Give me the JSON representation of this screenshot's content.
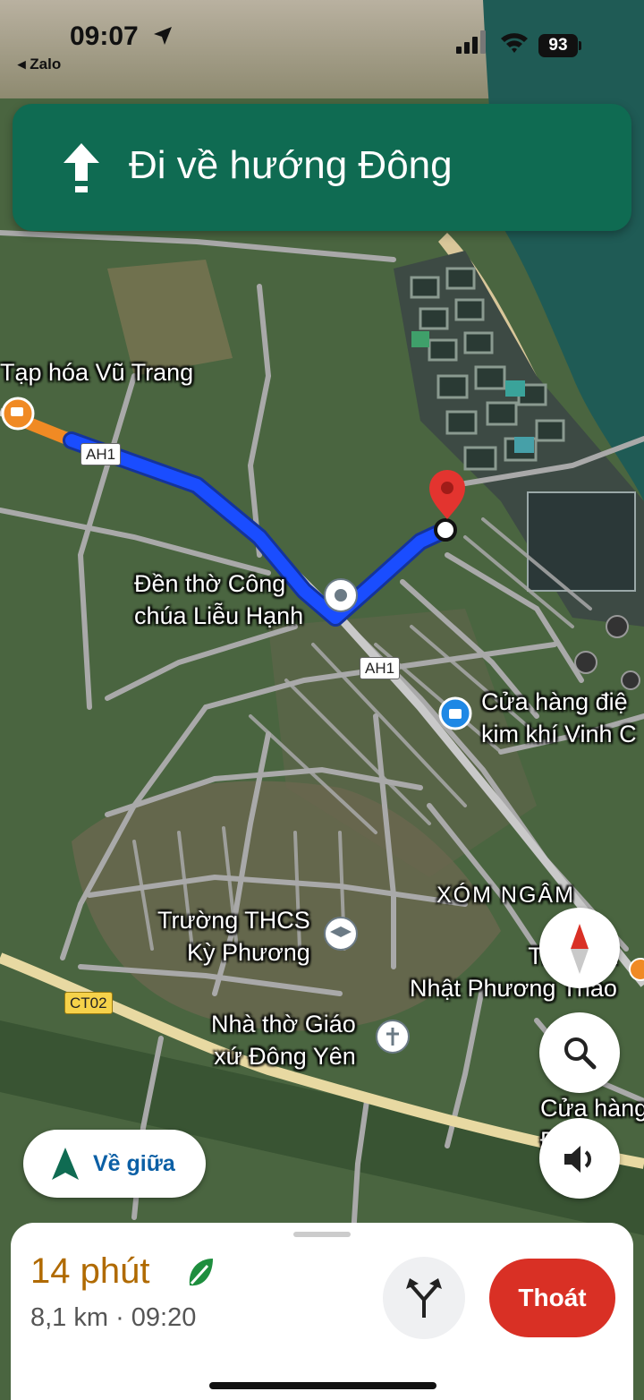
{
  "status_bar": {
    "time": "09:07",
    "back_app": "◂ Zalo",
    "battery": "93"
  },
  "navigation": {
    "instruction": "Đi về hướng Đông",
    "direction_icon": "straight-arrow-icon"
  },
  "map": {
    "places": [
      {
        "id": "tap-hoa",
        "name": "Tạp hóa Vũ Trang"
      },
      {
        "id": "den-tho",
        "name": "Đền thờ Công\nchúa Liễu Hạnh"
      },
      {
        "id": "cua-hang-dien",
        "name": "Cửa hàng điệ\nkim khí Vinh C"
      },
      {
        "id": "xom-ngam",
        "name": "XÓM NGÂM"
      },
      {
        "id": "truong",
        "name": "Trường THCS\nKỳ Phương"
      },
      {
        "id": "tiem",
        "name": "Tiệm Bá\nNhật Phương Thảo"
      },
      {
        "id": "nha-tho",
        "name": "Nhà thờ Giáo\nxứ Đông Yên"
      },
      {
        "id": "cua-hang-2",
        "name": "Cửa hàng\nĐè"
      }
    ],
    "road_shields": {
      "ah1_a": "AH1",
      "ah1_b": "AH1",
      "ct02": "CT02"
    },
    "colors": {
      "route": "#1a4dff",
      "route_traffic": "#f08a24",
      "destination_pin": "#e3342f"
    }
  },
  "controls": {
    "recenter_label": "Về giữa",
    "compass": "compass-icon",
    "search": "search-icon",
    "sound": "volume-icon"
  },
  "trip": {
    "duration": "14 phút",
    "details": "8,1 km · 09:20",
    "exit_label": "Thoát"
  }
}
